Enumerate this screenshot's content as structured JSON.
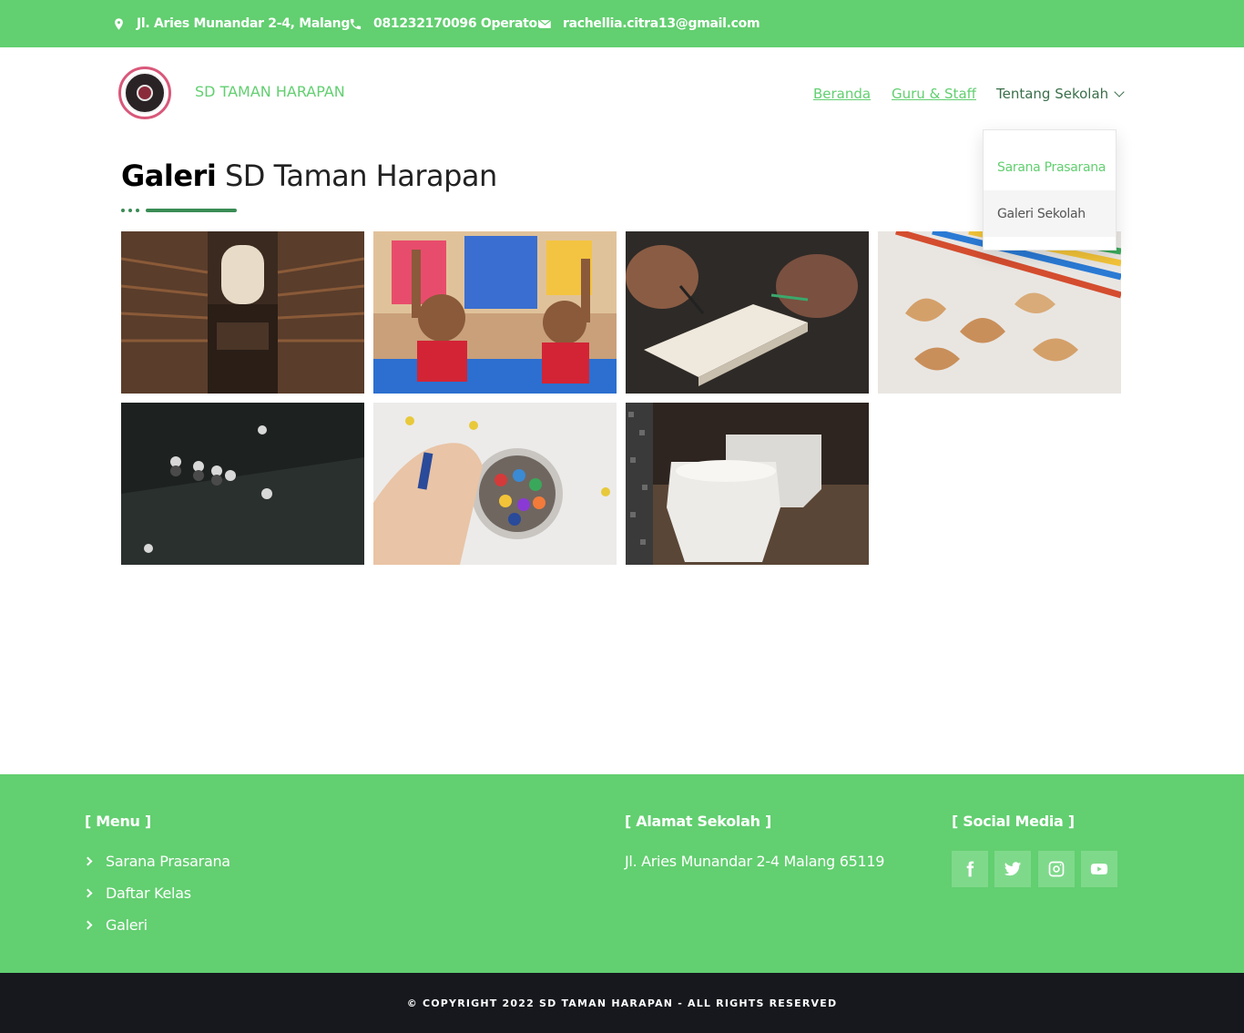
{
  "topbar": {
    "address": "Jl. Aries Munandar 2-4, Malang",
    "phone": "081232170096 Operator",
    "email": "rachellia.citra13@gmail.com",
    "icons": [
      "map-pin-icon",
      "phone-icon",
      "envelope-icon"
    ]
  },
  "header": {
    "brand": "SD TAMAN HARAPAN",
    "nav": {
      "home": "Beranda",
      "staff": "Guru & Staff",
      "about": "Tentang Sekolah"
    },
    "dropdown": {
      "items": [
        "Sarana Prasarana",
        "Galeri Sekolah"
      ]
    }
  },
  "main": {
    "title_bold": "Galeri",
    "title_rest": "SD Taman Harapan"
  },
  "gallery": {
    "images": [
      {
        "subject": "library"
      },
      {
        "subject": "children-raising-hands"
      },
      {
        "subject": "writing-in-notebook"
      },
      {
        "subject": "colored-pencil-shavings"
      },
      {
        "subject": "students-walking-overhead"
      },
      {
        "subject": "child-coloring-crayons"
      },
      {
        "subject": "toilet-room"
      }
    ]
  },
  "footer": {
    "menu_heading": "[ Menu ]",
    "menu_items": [
      "Sarana Prasarana",
      "Daftar Kelas",
      "Galeri"
    ],
    "address_heading": "[ Alamat Sekolah ]",
    "address": "Jl. Aries Munandar 2-4 Malang 65119",
    "social_heading": "[ Social Media ]",
    "social_icons": [
      "facebook-icon",
      "twitter-icon",
      "instagram-icon",
      "youtube-icon"
    ],
    "copyright": "© COPYRIGHT 2022 SD TAMAN HARAPAN - ALL RIGHTS RESERVED"
  },
  "colors": {
    "primary_green": "#62cf70",
    "dark_green": "#3a8c55",
    "bottom_bar": "#16181d"
  }
}
